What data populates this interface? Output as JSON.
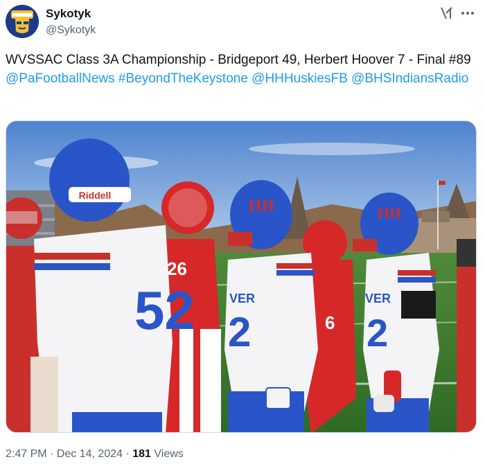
{
  "author": {
    "display_name": "Sykotyk",
    "handle": "@Sykotyk",
    "avatar_icon": "indian-chief-avatar"
  },
  "header_icons": {
    "grok": "grok-icon",
    "more": "more-options-icon"
  },
  "tweet": {
    "text": "WVSSAC Class 3A Championship - Bridgeport 49, Herbert Hoover 7 - Final #89",
    "links": [
      "@PaFootballNews",
      "#BeyondTheKeystone",
      "@HHHuskiesFB",
      "@BHSIndiansRadio"
    ]
  },
  "media": {
    "jerseys": {
      "left_number": "52",
      "left_helmet_brand": "Riddell",
      "center_number": "2",
      "right_number": "2",
      "red_number_left": "26",
      "red_number_mid": "6",
      "helmet_logo": "HH",
      "jersey_text": "VER"
    }
  },
  "meta": {
    "time": "2:47 PM",
    "separator": "·",
    "date": "Dec 14, 2024",
    "views_count": "181",
    "views_label": "Views"
  },
  "colors": {
    "link": "#1d9bf0",
    "secondary_text": "#536471",
    "primary_text": "#0f1419",
    "hoover_blue": "#2a55c8",
    "bridgeport_red": "#d62828"
  }
}
